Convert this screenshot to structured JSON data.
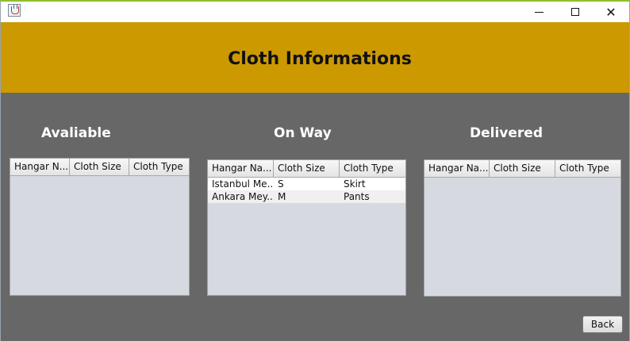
{
  "window": {
    "icon": "java-cup-icon",
    "controls": {
      "minimize": "minimize-icon",
      "maximize": "maximize-icon",
      "close_glyph": "✕"
    }
  },
  "header": {
    "title": "Cloth Informations",
    "background": "#cc9900"
  },
  "sections": {
    "available": {
      "title": "Avaliable",
      "columns": [
        "Hangar N...",
        "Cloth Size",
        "Cloth Type"
      ],
      "rows": []
    },
    "on_way": {
      "title": "On Way",
      "columns": [
        "Hangar Na...",
        "Cloth Size",
        "Cloth Type"
      ],
      "rows": [
        [
          "Istanbul Me...",
          "S",
          "Skirt"
        ],
        [
          "Ankara Mey...",
          "M",
          "Pants"
        ]
      ]
    },
    "delivered": {
      "title": "Delivered",
      "columns": [
        "Hangar Na...",
        "Cloth Size",
        "Cloth Type"
      ],
      "rows": []
    }
  },
  "footer": {
    "back_label": "Back"
  }
}
